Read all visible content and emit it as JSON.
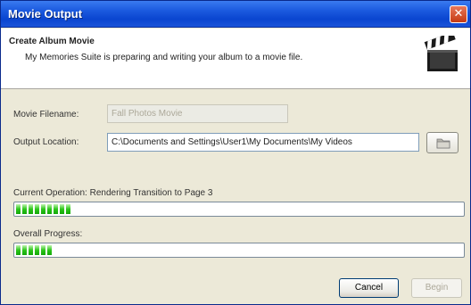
{
  "window": {
    "title": "Movie Output",
    "close_glyph": "✕"
  },
  "header": {
    "title": "Create Album Movie",
    "description": "My Memories Suite is preparing and writing your album to a movie file.",
    "icon": "clapperboard-icon"
  },
  "form": {
    "filename_label": "Movie Filename:",
    "filename_value": "Fall Photos Movie",
    "location_label": "Output Location:",
    "location_value": "C:\\Documents and Settings\\User1\\My Documents\\My Videos",
    "browse_icon": "folder-icon"
  },
  "progress": {
    "current_label": "Current Operation: Rendering Transition to Page 3",
    "current_fraction": 0.13,
    "overall_label": "Overall Progress:",
    "overall_fraction": 0.08
  },
  "buttons": {
    "cancel_label": "Cancel",
    "begin_label": "Begin"
  },
  "colors": {
    "titlebar": "#0a45d0",
    "progress_fill": "#2cc51a"
  }
}
